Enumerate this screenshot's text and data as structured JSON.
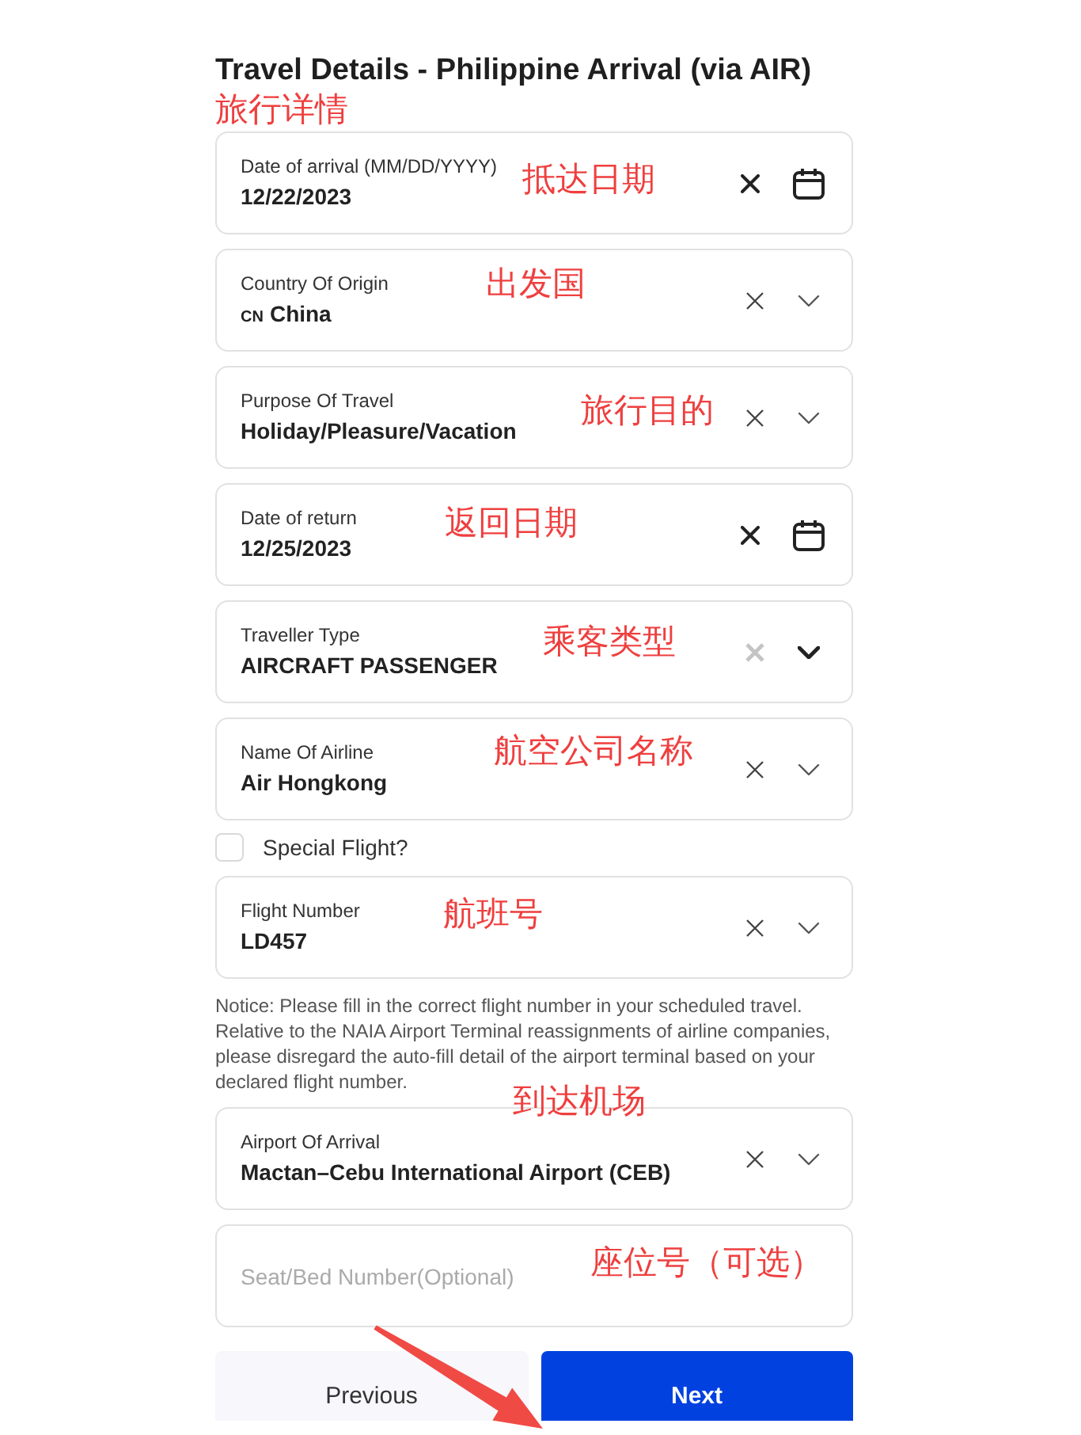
{
  "page": {
    "title": "Travel Details - Philippine Arrival (via AIR)",
    "title_annotation": "旅行详情"
  },
  "items": [
    {
      "kind": "date",
      "label": "Date of arrival (MM/DD/YYYY)",
      "value": "12/22/2023",
      "clear_disabled": false,
      "annotation": "抵达日期"
    },
    {
      "kind": "select",
      "label": "Country Of Origin",
      "prefix": "CN",
      "value": "China",
      "clear_disabled": false,
      "annotation": "出发国"
    },
    {
      "kind": "select",
      "label": "Purpose Of Travel",
      "value": "Holiday/Pleasure/Vacation",
      "clear_disabled": false,
      "annotation": "旅行目的"
    },
    {
      "kind": "date",
      "label": "Date of return",
      "value": "12/25/2023",
      "clear_disabled": false,
      "annotation": "返回日期"
    },
    {
      "kind": "select",
      "label": "Traveller Type",
      "value": "AIRCRAFT PASSENGER",
      "clear_disabled": true,
      "annotation": "乘客类型"
    },
    {
      "kind": "select",
      "label": "Name Of Airline",
      "value": "Air Hongkong",
      "clear_disabled": false,
      "annotation": "航空公司名称"
    },
    {
      "kind": "checkbox",
      "label": "Special Flight?",
      "checked": false
    },
    {
      "kind": "select",
      "label": "Flight Number",
      "value": "LD457",
      "clear_disabled": false,
      "annotation": "航班号"
    },
    {
      "kind": "notice",
      "text": "Notice: Please fill in the correct flight number in your scheduled travel. Relative to the NAIA Airport Terminal reassignments of airline companies, please disregard the auto-fill detail of the airport terminal based on your declared flight number."
    },
    {
      "kind": "select",
      "label": "Airport Of Arrival",
      "value": "Mactan–Cebu International Airport (CEB)",
      "clear_disabled": false,
      "annotation": "到达机场"
    },
    {
      "kind": "text",
      "placeholder": "Seat/Bed Number(Optional)",
      "annotation": "座位号（可选）"
    }
  ],
  "buttons": [
    {
      "kind": "secondary",
      "label": "Previous"
    },
    {
      "kind": "primary",
      "label": "Next"
    }
  ]
}
